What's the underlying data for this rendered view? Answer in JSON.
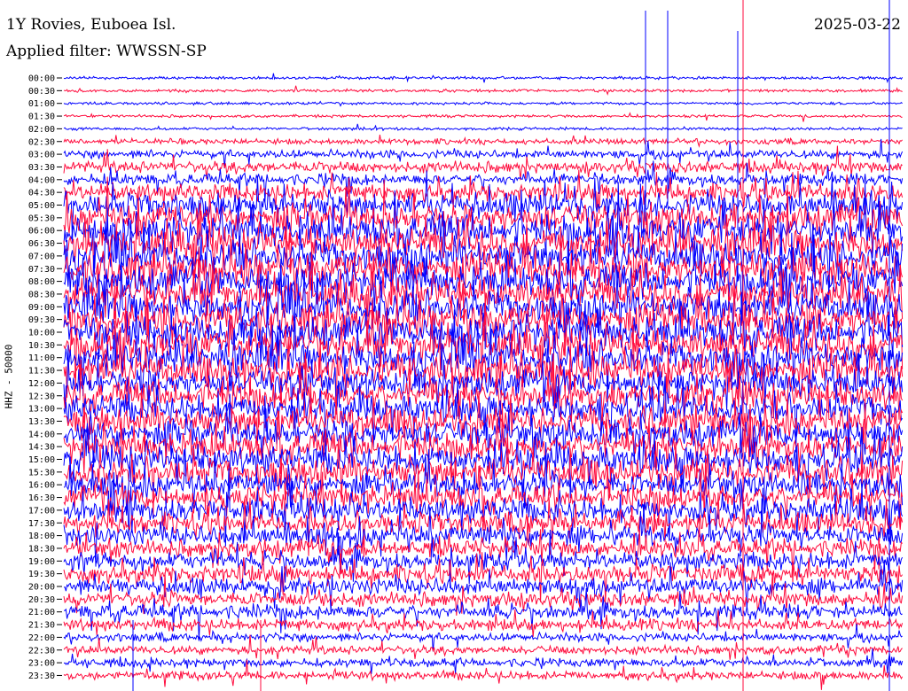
{
  "header": {
    "station": "1Y Rovies, Euboea Isl.",
    "date": "2025-03-22",
    "filter": "Applied filter: WWSSN-SP"
  },
  "chart_data": {
    "type": "line",
    "title": "1Y Rovies, Euboea Isl.",
    "subtitle": "Applied filter: WWSSN-SP",
    "ylabel": "HHZ - 50000",
    "row_labels": [
      "00:00",
      "00:30",
      "01:00",
      "01:30",
      "02:00",
      "02:30",
      "03:00",
      "03:30",
      "04:00",
      "04:30",
      "05:00",
      "05:30",
      "06:00",
      "06:30",
      "07:00",
      "07:30",
      "08:00",
      "08:30",
      "09:00",
      "09:30",
      "10:00",
      "10:30",
      "11:00",
      "11:30",
      "12:00",
      "12:30",
      "13:00",
      "13:30",
      "14:00",
      "14:30",
      "15:00",
      "15:30",
      "16:00",
      "16:30",
      "17:00",
      "17:30",
      "18:00",
      "18:30",
      "19:00",
      "19:30",
      "20:00",
      "20:30",
      "21:00",
      "21:30",
      "22:00",
      "22:30",
      "23:00",
      "23:30"
    ],
    "row_amplitude": [
      1,
      1,
      1,
      1,
      1,
      2,
      3,
      4,
      4,
      6,
      8,
      9,
      10,
      10,
      10,
      10,
      10,
      10,
      10,
      10,
      10,
      10,
      10,
      10,
      9,
      9,
      9,
      9,
      9,
      9,
      9,
      9,
      8,
      8,
      8,
      7,
      7,
      6,
      6,
      6,
      6,
      5,
      5,
      4,
      3,
      3,
      3,
      3
    ],
    "series_colors": [
      "#0000ff",
      "#ff0a3c"
    ],
    "grid": false,
    "legend": "none"
  }
}
